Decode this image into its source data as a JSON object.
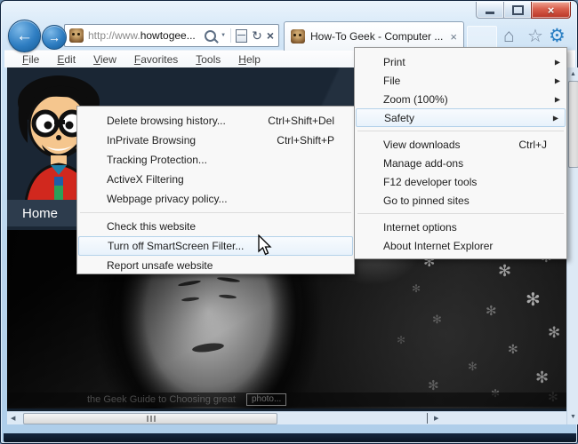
{
  "icons": {
    "close": "×",
    "back": "←",
    "forward": "→",
    "refresh": "↻",
    "stop": "×",
    "dropdown_caret": "▼",
    "home": "⌂",
    "favorites_star": "☆",
    "tools_gear": "⚙",
    "tab_close": "×",
    "submenu_arrow": "▶",
    "scroll_up": "▲",
    "scroll_down": "▼",
    "scroll_left": "◀",
    "scroll_right": "▶",
    "flower": "✻"
  },
  "colors": {
    "accent_blue": "#2a7fc4",
    "close_red": "#b83525",
    "aero_frame": "#bad6ee",
    "menu_highlight_border": "#b5d2ea",
    "banner_navy": "#1a2634"
  },
  "address_bar": {
    "url_prefix": "http://www.",
    "url_domain": "howtogee..."
  },
  "tab": {
    "title": "How-To Geek - Computer ..."
  },
  "menubar": {
    "items": [
      "File",
      "Edit",
      "View",
      "Favorites",
      "Tools",
      "Help"
    ]
  },
  "tools_menu": {
    "items": [
      {
        "label": "Print",
        "has_submenu": true
      },
      {
        "label": "File",
        "has_submenu": true
      },
      {
        "label": "Zoom (100%)",
        "has_submenu": true
      },
      {
        "label": "Safety",
        "has_submenu": true,
        "highlighted": true
      },
      {
        "label": "View downloads",
        "shortcut": "Ctrl+J"
      },
      {
        "label": "Manage add-ons"
      },
      {
        "label": "F12 developer tools"
      },
      {
        "label": "Go to pinned sites"
      },
      {
        "label": "Internet options"
      },
      {
        "label": "About Internet Explorer"
      }
    ]
  },
  "safety_menu": {
    "items": [
      {
        "label": "Delete browsing history...",
        "shortcut": "Ctrl+Shift+Del"
      },
      {
        "label": "InPrivate Browsing",
        "shortcut": "Ctrl+Shift+P"
      },
      {
        "label": "Tracking Protection..."
      },
      {
        "label": "ActiveX Filtering"
      },
      {
        "label": "Webpage privacy policy..."
      },
      {
        "label": "Check this website"
      },
      {
        "label": "Turn off SmartScreen Filter...",
        "highlighted": true
      },
      {
        "label": "Report unsafe website"
      }
    ]
  },
  "page": {
    "nav_home": "Home",
    "photo_caption": "the Geek Guide to Choosing great",
    "photo_caption_chip": "photo..."
  }
}
